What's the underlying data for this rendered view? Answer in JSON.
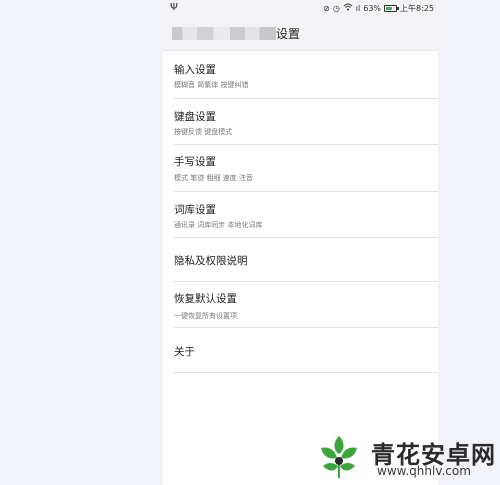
{
  "status_bar": {
    "usb_icon": "usb-icon",
    "signal_text": "ıl",
    "battery_percent": "63%",
    "battery_level": 0.63,
    "time": "上午8:25"
  },
  "header": {
    "title_suffix": "设置"
  },
  "settings": [
    {
      "title": "输入设置",
      "subtitle": "模糊音 简繁体 按键纠错"
    },
    {
      "title": "键盘设置",
      "subtitle": "按键反馈 键盘模式"
    },
    {
      "title": "手写设置",
      "subtitle": "模式 笔迹 粗细 速度 注音"
    },
    {
      "title": "词库设置",
      "subtitle": "通讯录 词库同步 本地化词库"
    },
    {
      "title": "隐私及权限说明",
      "subtitle": ""
    },
    {
      "title": "恢复默认设置",
      "subtitle": "一键恢复所有设置项"
    },
    {
      "title": "关于",
      "subtitle": ""
    }
  ],
  "watermark": {
    "name": "青花安卓网",
    "url": "www.qhhlv.com",
    "colors": {
      "green": "#3aa53a",
      "dark": "#2a2a2a"
    }
  }
}
